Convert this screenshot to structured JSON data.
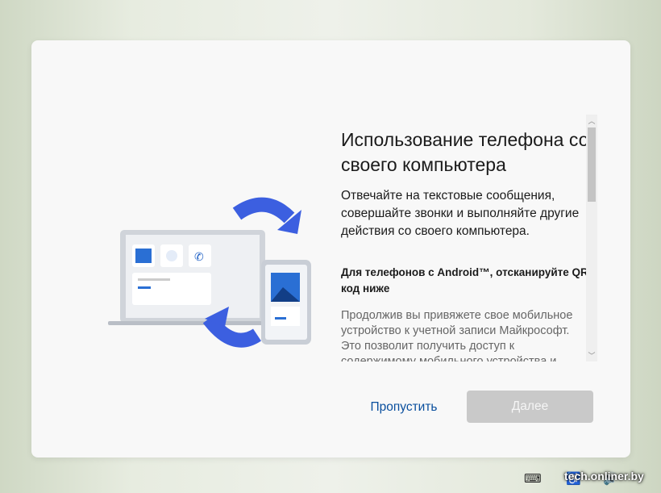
{
  "title": "Использование телефона со своего компьютера",
  "subtitle": "Отвечайте на текстовые сообщения, совершайте звонки и выполняйте другие действия со своего компьютера.",
  "android_heading": "Для телефонов с Android™, отсканируйте QR-код ниже",
  "description": "Продолжив вы привяжете свое мобильное устройство к учетной записи Майкрософт. Это позволит получить доступ к содержимому мобильного устройства и",
  "buttons": {
    "skip": "Пропустить",
    "next": "Далее"
  },
  "watermark": "tech.onliner.by",
  "scroll_position": 0
}
